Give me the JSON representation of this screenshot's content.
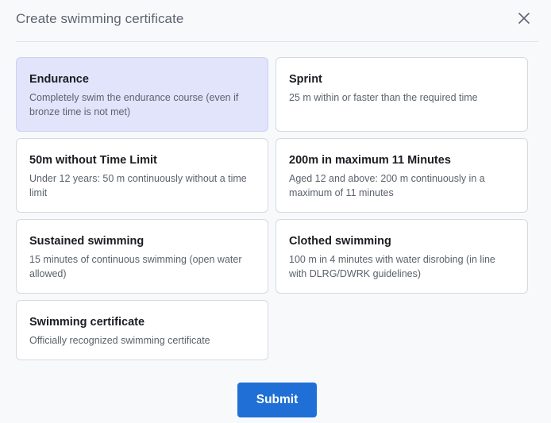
{
  "dialog": {
    "title": "Create swimming certificate",
    "close_icon": "close-icon"
  },
  "options": [
    {
      "title": "Endurance",
      "description": "Completely swim the endurance course (even if bronze time is not met)",
      "selected": true
    },
    {
      "title": "Sprint",
      "description": "25 m within or faster than the required time",
      "selected": false
    },
    {
      "title": "50m without Time Limit",
      "description": "Under 12 years: 50 m continuously without a time limit",
      "selected": false
    },
    {
      "title": "200m in maximum 11 Minutes",
      "description": "Aged 12 and above: 200 m continuously in a maximum of 11 minutes",
      "selected": false
    },
    {
      "title": "Sustained swimming",
      "description": "15 minutes of continuous swimming (open water allowed)",
      "selected": false
    },
    {
      "title": "Clothed swimming",
      "description": "100 m in 4 minutes with water disrobing (in line with DLRG/DWRK guidelines)",
      "selected": false
    },
    {
      "title": "Swimming certificate",
      "description": "Officially recognized swimming certificate",
      "selected": false
    }
  ],
  "footer": {
    "submit_label": "Submit"
  },
  "colors": {
    "accent": "#1f6fd6",
    "selected_card": "#e2e4fc",
    "card_border": "#d6dae0",
    "background": "#f8f9fb"
  }
}
